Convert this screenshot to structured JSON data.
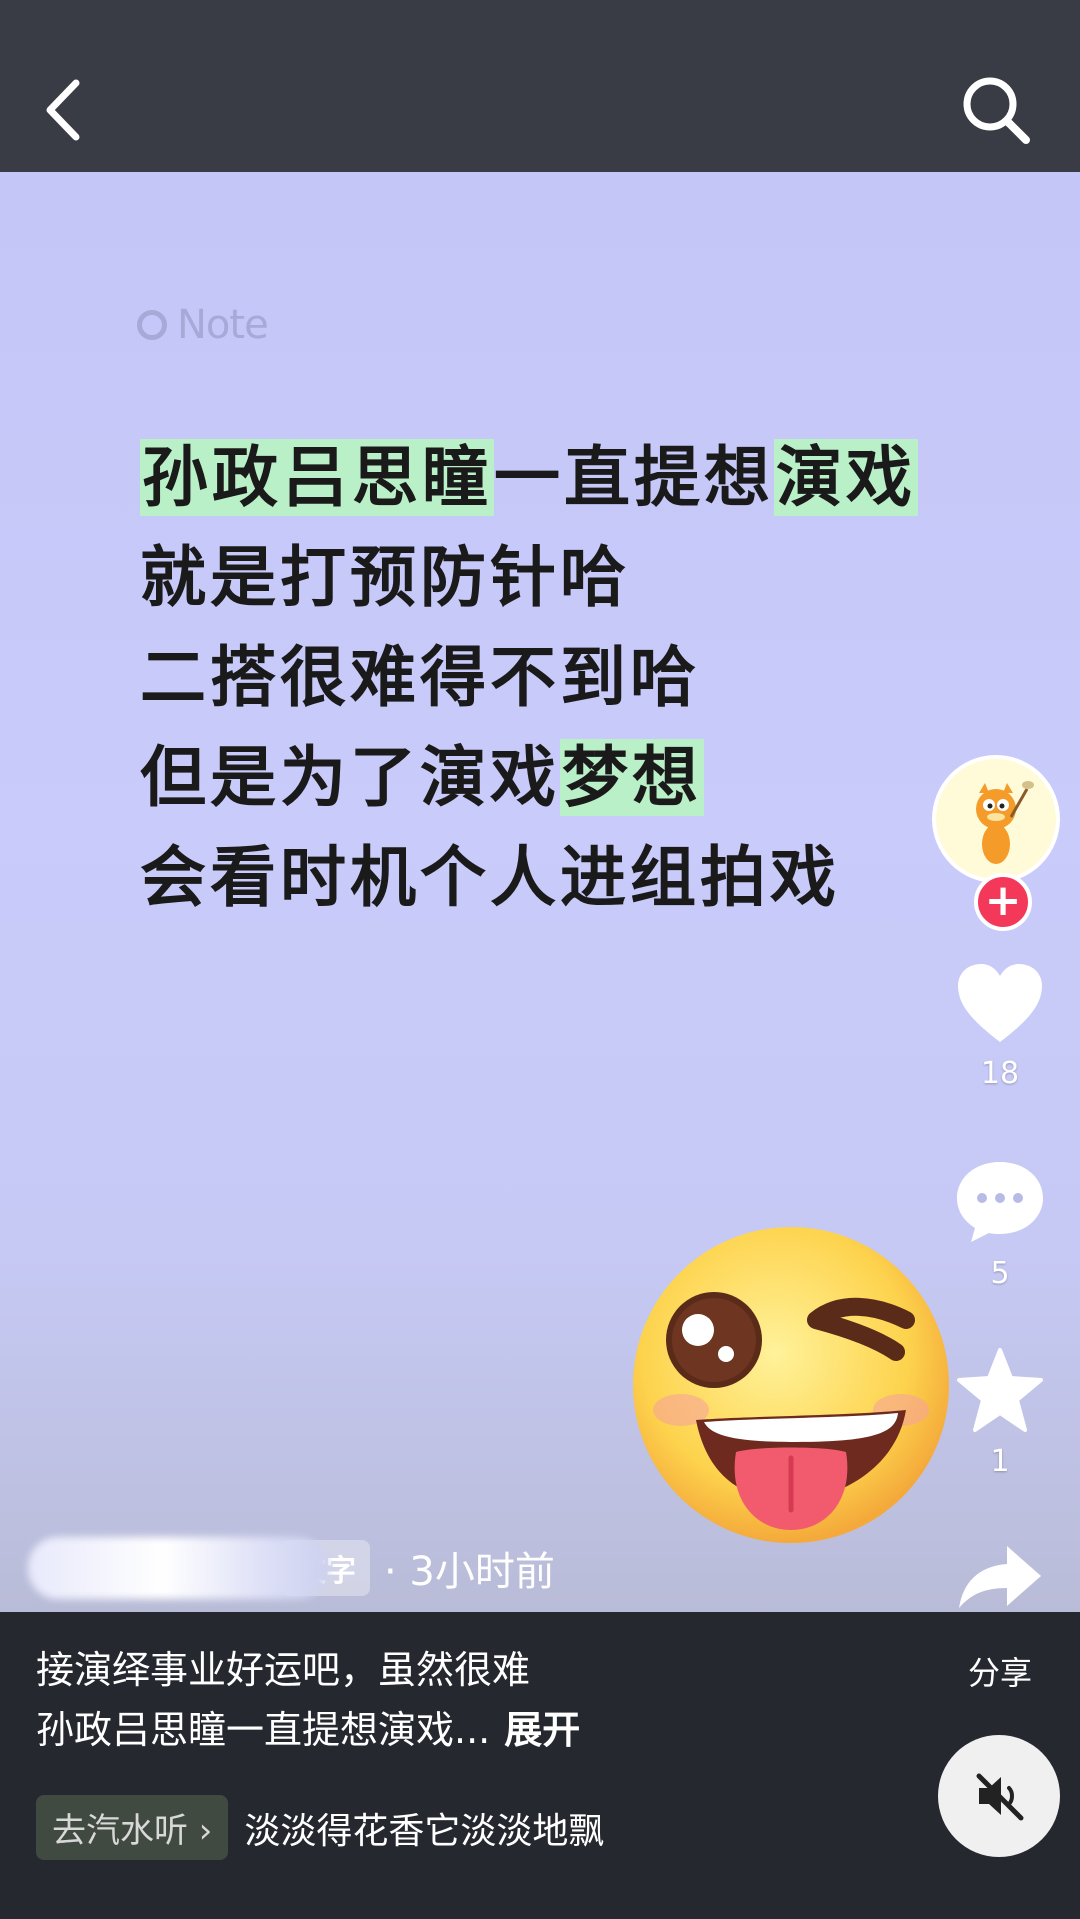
{
  "header": {
    "back_icon": "chevron-left-icon",
    "search_icon": "search-icon"
  },
  "note": {
    "tag": "Note",
    "lines": [
      [
        {
          "t": "孙政吕思瞳",
          "hl": true
        },
        {
          "t": "一直提想",
          "hl": false
        },
        {
          "t": "演戏",
          "hl": true
        }
      ],
      [
        {
          "t": "就是打预防针哈",
          "hl": false
        }
      ],
      [
        {
          "t": "二搭很难得不到哈",
          "hl": false
        }
      ],
      [
        {
          "t": "但是为了演戏",
          "hl": false
        },
        {
          "t": "梦想",
          "hl": true
        }
      ],
      [
        {
          "t": "会看时机个人进组拍戏",
          "hl": false
        }
      ]
    ],
    "highlight_color": "#b9f0c8"
  },
  "sidebar": {
    "follow_icon": "plus-icon",
    "like_count": "18",
    "comment_count": "5",
    "favorite_count": "1",
    "share_label": "分享"
  },
  "meta": {
    "tag": "文字",
    "time": "· 3小时前"
  },
  "caption": {
    "line1": "接演绎事业好运吧，虽然很难",
    "line2": "孙政吕思瞳一直提想演戏...",
    "expand": "展开"
  },
  "music": {
    "chip": "去汽水听 ›",
    "title": "淡淡得花香它淡淡地飘"
  },
  "colors": {
    "accent_red": "#f3385a",
    "topbar": "#3a3c45",
    "card_bg": "#c6c9f7"
  }
}
